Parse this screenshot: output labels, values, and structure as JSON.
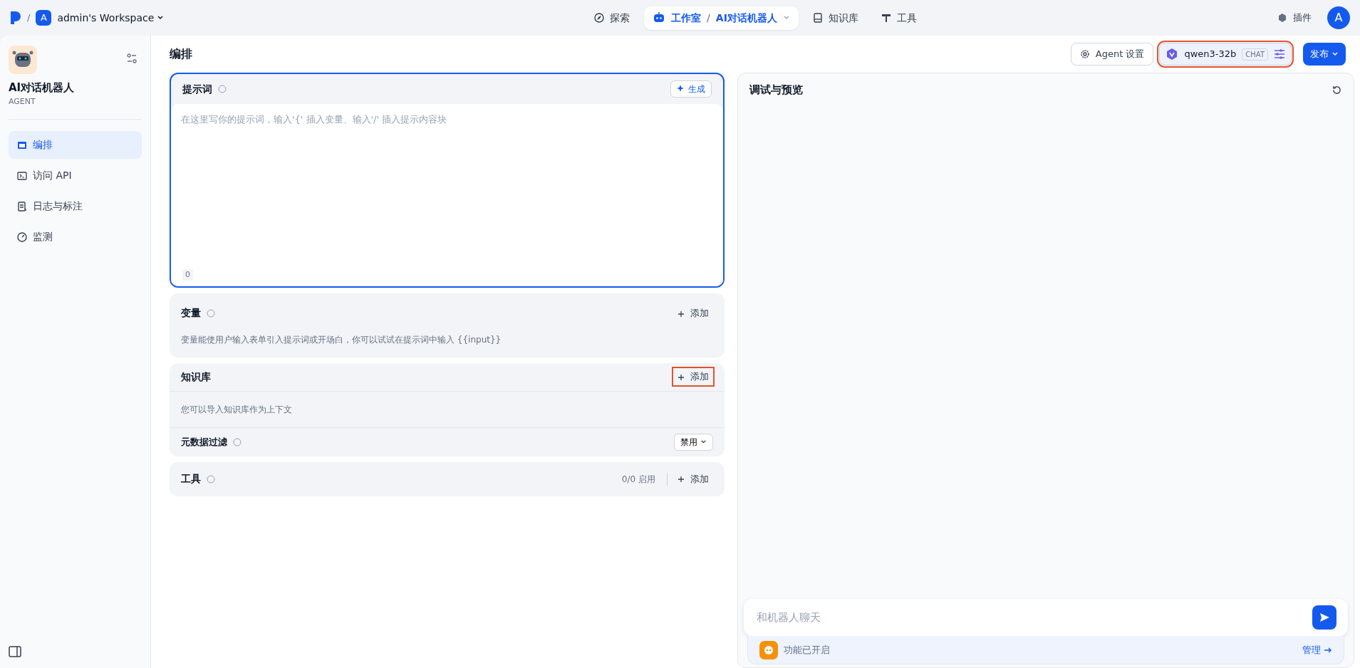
{
  "topbar": {
    "separator": "/",
    "workspace_initial": "A",
    "workspace_name": "admin's Workspace",
    "nav": [
      {
        "kind": "link",
        "label": "探索",
        "selected": false
      },
      {
        "kind": "crumb",
        "label": "工作室",
        "separator": "/",
        "current": "AI对话机器人",
        "selected": true
      },
      {
        "kind": "link",
        "label": "知识库",
        "selected": false
      },
      {
        "kind": "link",
        "label": "工具",
        "selected": false
      }
    ],
    "plugins": "插件",
    "avatar": "A"
  },
  "app": {
    "name": "AI对话机器人",
    "type": "AGENT"
  },
  "sidebar": {
    "items": [
      {
        "label": "编排",
        "selected": true
      },
      {
        "label": "访问 API",
        "selected": false
      },
      {
        "label": "日志与标注",
        "selected": false
      },
      {
        "label": "监测",
        "selected": false
      }
    ]
  },
  "header": {
    "title": "编排",
    "agent_settings": "Agent 设置",
    "model": {
      "name": "qwen3-32b",
      "mode": "CHAT",
      "highlighted": true
    },
    "publish": "发布"
  },
  "prompt": {
    "title": "提示词",
    "generate": "生成",
    "placeholder": "在这里写你的提示词，输入'{' 插入变量、输入'/' 插入提示内容块",
    "count": "0"
  },
  "variables": {
    "title": "变量",
    "add": "添加",
    "description": "变量能使用户输入表单引入提示词或开场白，你可以试试在提示词中输入 {{input}}"
  },
  "knowledge": {
    "title": "知识库",
    "add": "添加",
    "add_highlighted": true,
    "description": "您可以导入知识库作为上下文",
    "metadata_filter": {
      "label": "元数据过滤",
      "value": "禁用"
    }
  },
  "tools": {
    "title": "工具",
    "count": "0/0 启用",
    "add": "添加"
  },
  "preview": {
    "title": "调试与预览",
    "chat_placeholder": "和机器人聊天",
    "feature_status": "功能已开启",
    "manage": "管理"
  }
}
